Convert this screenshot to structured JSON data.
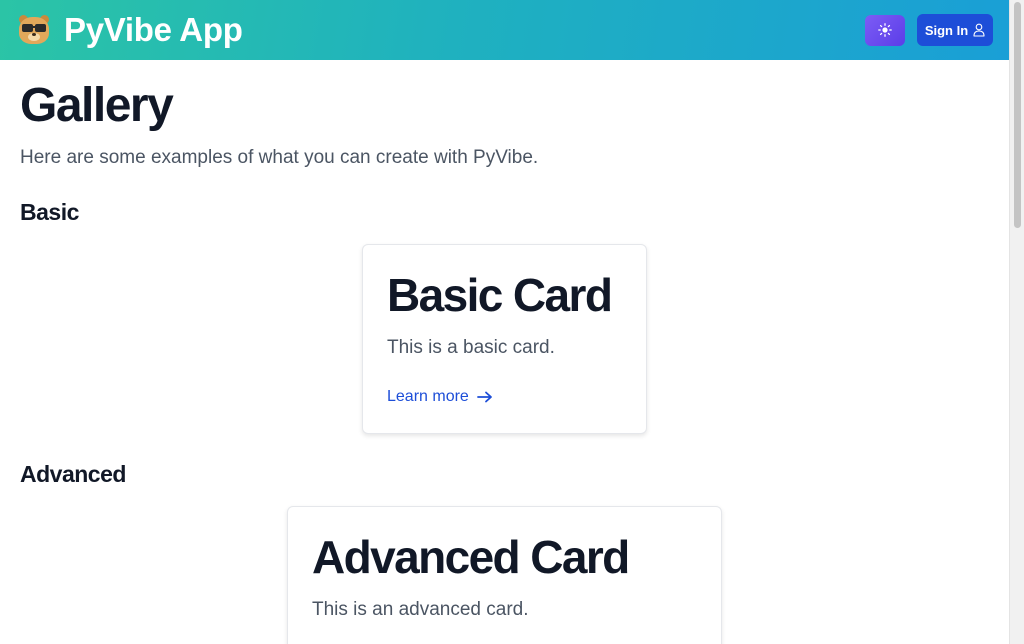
{
  "header": {
    "app_name": "PyVibe App",
    "logo_icon": "bear-with-glasses-icon",
    "theme_icon": "sun-icon",
    "signin_label": "Sign In",
    "signin_icon": "user-icon",
    "gradient_colors": [
      "#2bc4a6",
      "#1a9fd6"
    ],
    "theme_button_color": "#6d4df0",
    "signin_button_color": "#1d4ed8"
  },
  "page": {
    "title": "Gallery",
    "subtitle": "Here are some examples of what you can create with PyVibe."
  },
  "sections": [
    {
      "heading": "Basic",
      "card": {
        "title": "Basic Card",
        "body": "This is a basic card.",
        "link_label": "Learn more",
        "link_icon": "arrow-right-icon"
      }
    },
    {
      "heading": "Advanced",
      "card": {
        "title": "Advanced Card",
        "body": "This is an advanced card."
      }
    }
  ]
}
